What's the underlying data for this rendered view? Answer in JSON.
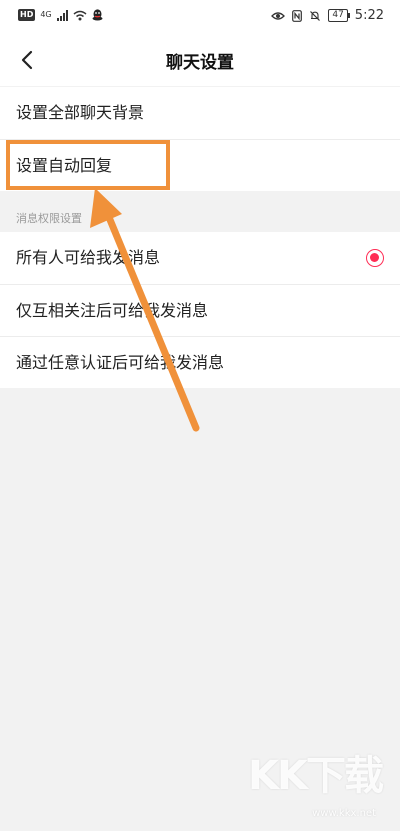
{
  "status_bar": {
    "left_badge": "HD",
    "network": "4G",
    "time": "5:22",
    "battery": "47",
    "icons": [
      "signal-icon",
      "wifi-icon",
      "qq-icon",
      "eye-icon",
      "nfc-icon",
      "mute-bell-icon",
      "battery-icon"
    ]
  },
  "nav": {
    "title": "聊天设置",
    "back_icon": "chevron-left-icon"
  },
  "settings": {
    "items": [
      {
        "label": "设置全部聊天背景"
      },
      {
        "label": "设置自动回复"
      }
    ]
  },
  "permissions": {
    "section_label": "消息权限设置",
    "options": [
      {
        "label": "所有人可给我发消息",
        "selected": true
      },
      {
        "label": "仅互相关注后可给我发消息",
        "selected": false
      },
      {
        "label": "通过任意认证后可给我发消息",
        "selected": false
      }
    ]
  },
  "annotation": {
    "highlight_color": "#f0913a",
    "accent_radio_color": "#ff2d55"
  },
  "watermark": {
    "logo_text": "KK下载",
    "url": "www.kkx.net"
  }
}
